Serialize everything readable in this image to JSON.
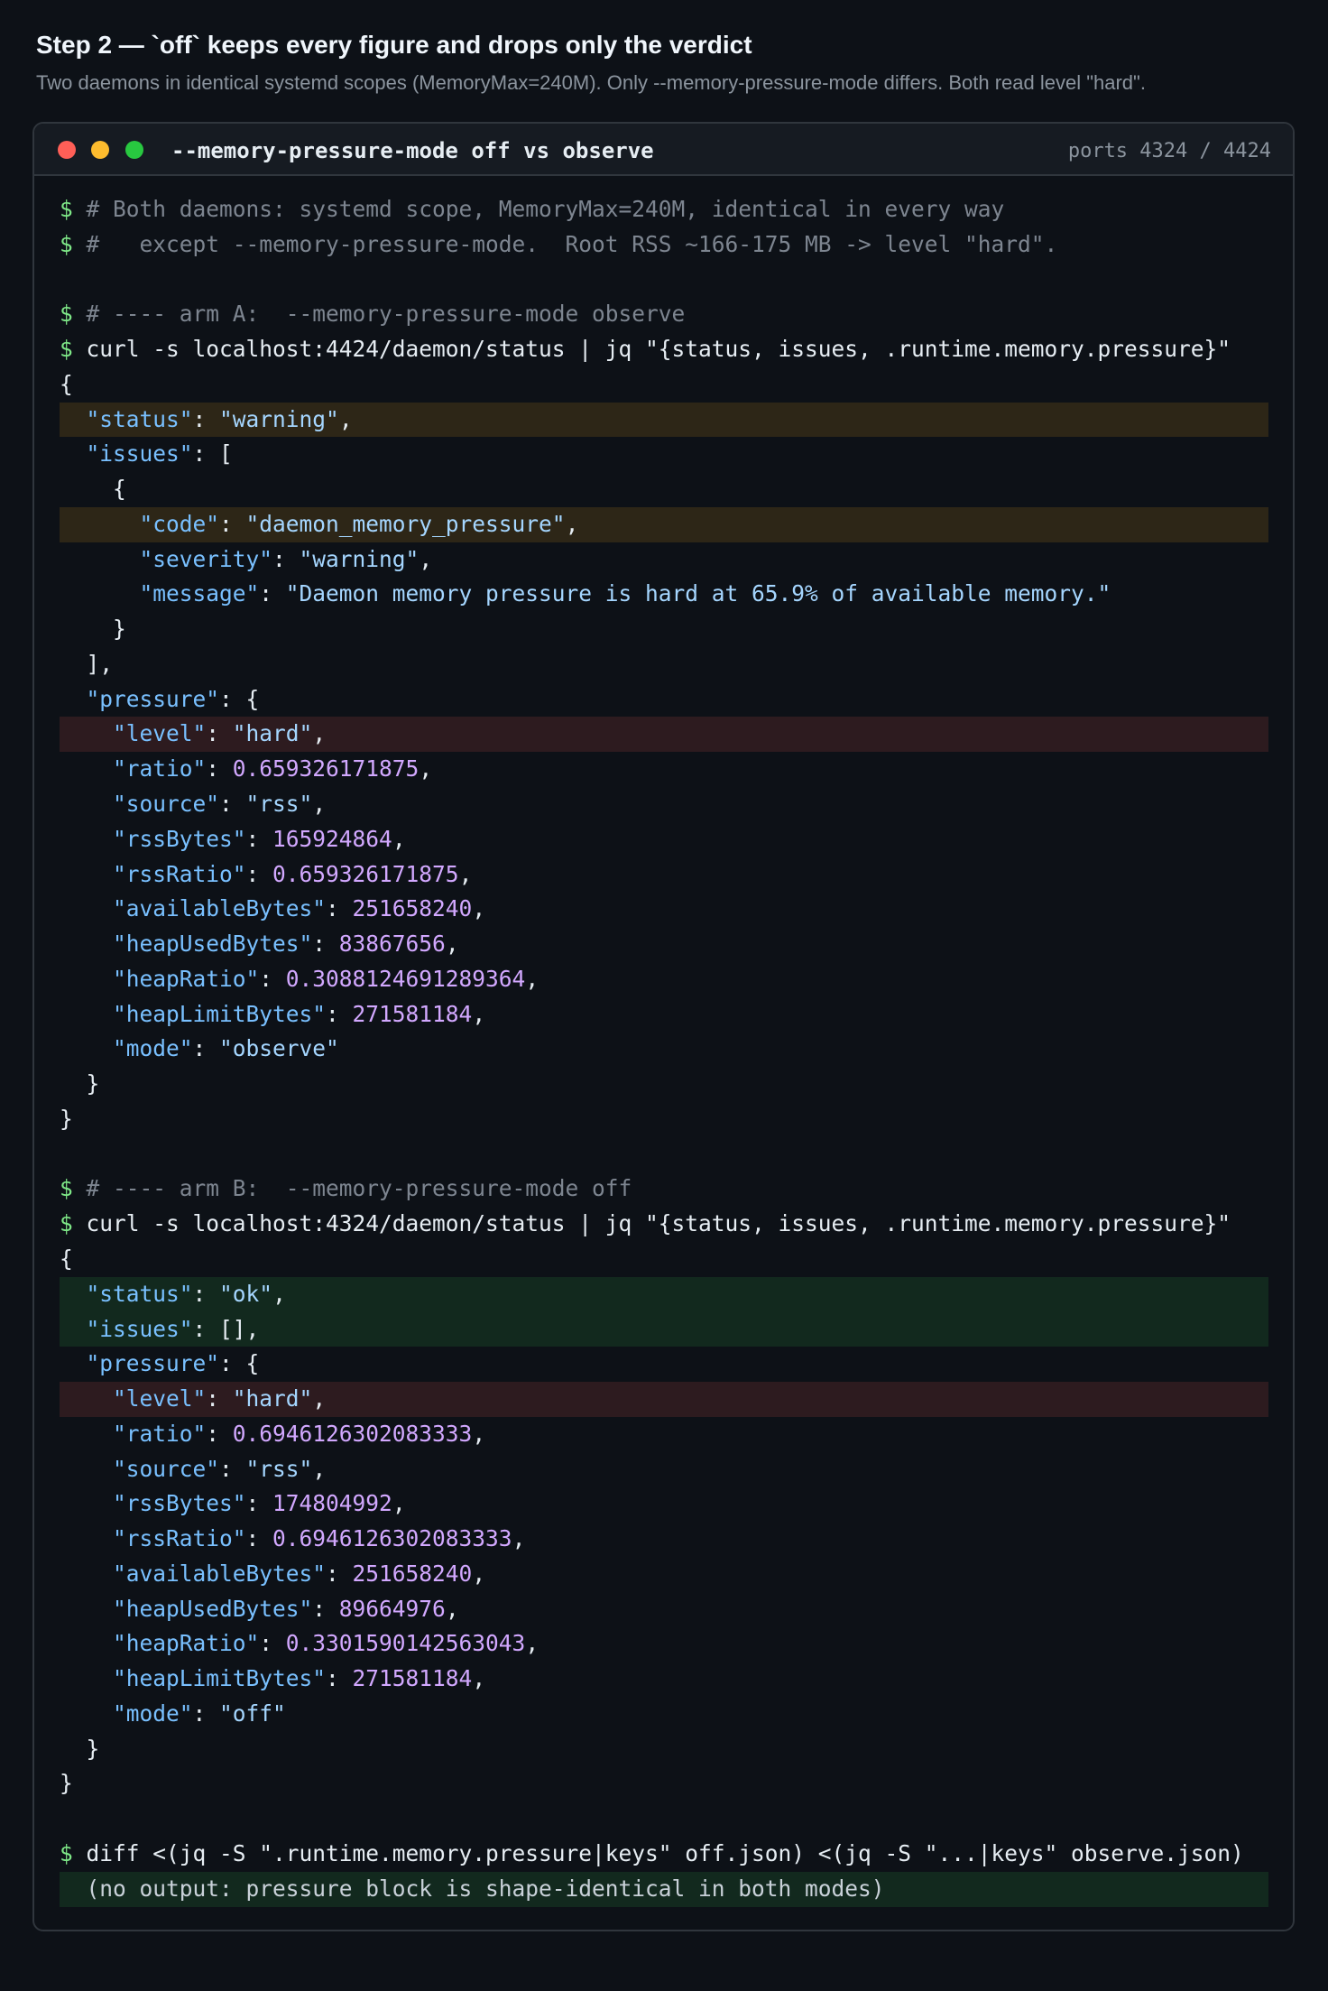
{
  "heading": "Step 2 — `off` keeps every figure and drops only the verdict",
  "subheading": "Two daemons in identical systemd scopes (MemoryMax=240M). Only --memory-pressure-mode differs. Both read level \"hard\".",
  "terminal": {
    "title": "--memory-pressure-mode off vs observe",
    "ports": "ports 4324 / 4424",
    "window_controls": [
      "close-dot",
      "minimize-dot",
      "maximize-dot"
    ],
    "colors": {
      "highlight_warning": "#2d2617",
      "highlight_level": "#2d1b1f",
      "highlight_ok": "#12291e",
      "prompt": "#7ee787",
      "key": "#79c0ff",
      "number": "#d2a8ff"
    }
  },
  "lines": [
    {
      "hl": "",
      "segs": [
        {
          "t": "p",
          "v": "$ "
        },
        {
          "t": "c",
          "v": "# Both daemons: systemd scope, MemoryMax=240M, identical in every way"
        }
      ]
    },
    {
      "hl": "",
      "segs": [
        {
          "t": "p",
          "v": "$ "
        },
        {
          "t": "c",
          "v": "#   except --memory-pressure-mode.  Root RSS ~166-175 MB -> level \"hard\"."
        }
      ]
    },
    {
      "hl": "",
      "segs": []
    },
    {
      "hl": "",
      "segs": [
        {
          "t": "p",
          "v": "$ "
        },
        {
          "t": "c",
          "v": "# ---- arm A:  --memory-pressure-mode observe"
        }
      ]
    },
    {
      "hl": "",
      "segs": [
        {
          "t": "p",
          "v": "$ "
        },
        {
          "t": "w",
          "v": "curl -s localhost:4424/daemon/status | jq \"{status, issues, .runtime.memory.pressure}\""
        }
      ]
    },
    {
      "hl": "",
      "segs": [
        {
          "t": "w",
          "v": "{"
        }
      ]
    },
    {
      "hl": "amber",
      "segs": [
        {
          "t": "w",
          "v": "  "
        },
        {
          "t": "k",
          "v": "\"status\""
        },
        {
          "t": "w",
          "v": ": "
        },
        {
          "t": "s",
          "v": "\"warning\""
        },
        {
          "t": "w",
          "v": ","
        }
      ]
    },
    {
      "hl": "",
      "segs": [
        {
          "t": "w",
          "v": "  "
        },
        {
          "t": "k",
          "v": "\"issues\""
        },
        {
          "t": "w",
          "v": ": ["
        }
      ]
    },
    {
      "hl": "",
      "segs": [
        {
          "t": "w",
          "v": "    {"
        }
      ]
    },
    {
      "hl": "amber",
      "segs": [
        {
          "t": "w",
          "v": "      "
        },
        {
          "t": "k",
          "v": "\"code\""
        },
        {
          "t": "w",
          "v": ": "
        },
        {
          "t": "s",
          "v": "\"daemon_memory_pressure\""
        },
        {
          "t": "w",
          "v": ","
        }
      ]
    },
    {
      "hl": "",
      "segs": [
        {
          "t": "w",
          "v": "      "
        },
        {
          "t": "k",
          "v": "\"severity\""
        },
        {
          "t": "w",
          "v": ": "
        },
        {
          "t": "s",
          "v": "\"warning\""
        },
        {
          "t": "w",
          "v": ","
        }
      ]
    },
    {
      "hl": "",
      "segs": [
        {
          "t": "w",
          "v": "      "
        },
        {
          "t": "k",
          "v": "\"message\""
        },
        {
          "t": "w",
          "v": ": "
        },
        {
          "t": "s",
          "v": "\"Daemon memory pressure is hard at 65.9% of available memory.\""
        }
      ]
    },
    {
      "hl": "",
      "segs": [
        {
          "t": "w",
          "v": "    }"
        }
      ]
    },
    {
      "hl": "",
      "segs": [
        {
          "t": "w",
          "v": "  ],"
        }
      ]
    },
    {
      "hl": "",
      "segs": [
        {
          "t": "w",
          "v": "  "
        },
        {
          "t": "k",
          "v": "\"pressure\""
        },
        {
          "t": "w",
          "v": ": {"
        }
      ]
    },
    {
      "hl": "red",
      "segs": [
        {
          "t": "w",
          "v": "    "
        },
        {
          "t": "k",
          "v": "\"level\""
        },
        {
          "t": "w",
          "v": ": "
        },
        {
          "t": "s",
          "v": "\"hard\""
        },
        {
          "t": "w",
          "v": ","
        }
      ]
    },
    {
      "hl": "",
      "segs": [
        {
          "t": "w",
          "v": "    "
        },
        {
          "t": "k",
          "v": "\"ratio\""
        },
        {
          "t": "w",
          "v": ": "
        },
        {
          "t": "n",
          "v": "0.659326171875"
        },
        {
          "t": "w",
          "v": ","
        }
      ]
    },
    {
      "hl": "",
      "segs": [
        {
          "t": "w",
          "v": "    "
        },
        {
          "t": "k",
          "v": "\"source\""
        },
        {
          "t": "w",
          "v": ": "
        },
        {
          "t": "s",
          "v": "\"rss\""
        },
        {
          "t": "w",
          "v": ","
        }
      ]
    },
    {
      "hl": "",
      "segs": [
        {
          "t": "w",
          "v": "    "
        },
        {
          "t": "k",
          "v": "\"rssBytes\""
        },
        {
          "t": "w",
          "v": ": "
        },
        {
          "t": "n",
          "v": "165924864"
        },
        {
          "t": "w",
          "v": ","
        }
      ]
    },
    {
      "hl": "",
      "segs": [
        {
          "t": "w",
          "v": "    "
        },
        {
          "t": "k",
          "v": "\"rssRatio\""
        },
        {
          "t": "w",
          "v": ": "
        },
        {
          "t": "n",
          "v": "0.659326171875"
        },
        {
          "t": "w",
          "v": ","
        }
      ]
    },
    {
      "hl": "",
      "segs": [
        {
          "t": "w",
          "v": "    "
        },
        {
          "t": "k",
          "v": "\"availableBytes\""
        },
        {
          "t": "w",
          "v": ": "
        },
        {
          "t": "n",
          "v": "251658240"
        },
        {
          "t": "w",
          "v": ","
        }
      ]
    },
    {
      "hl": "",
      "segs": [
        {
          "t": "w",
          "v": "    "
        },
        {
          "t": "k",
          "v": "\"heapUsedBytes\""
        },
        {
          "t": "w",
          "v": ": "
        },
        {
          "t": "n",
          "v": "83867656"
        },
        {
          "t": "w",
          "v": ","
        }
      ]
    },
    {
      "hl": "",
      "segs": [
        {
          "t": "w",
          "v": "    "
        },
        {
          "t": "k",
          "v": "\"heapRatio\""
        },
        {
          "t": "w",
          "v": ": "
        },
        {
          "t": "n",
          "v": "0.3088124691289364"
        },
        {
          "t": "w",
          "v": ","
        }
      ]
    },
    {
      "hl": "",
      "segs": [
        {
          "t": "w",
          "v": "    "
        },
        {
          "t": "k",
          "v": "\"heapLimitBytes\""
        },
        {
          "t": "w",
          "v": ": "
        },
        {
          "t": "n",
          "v": "271581184"
        },
        {
          "t": "w",
          "v": ","
        }
      ]
    },
    {
      "hl": "",
      "segs": [
        {
          "t": "w",
          "v": "    "
        },
        {
          "t": "k",
          "v": "\"mode\""
        },
        {
          "t": "w",
          "v": ": "
        },
        {
          "t": "s",
          "v": "\"observe\""
        }
      ]
    },
    {
      "hl": "",
      "segs": [
        {
          "t": "w",
          "v": "  }"
        }
      ]
    },
    {
      "hl": "",
      "segs": [
        {
          "t": "w",
          "v": "}"
        }
      ]
    },
    {
      "hl": "",
      "segs": []
    },
    {
      "hl": "",
      "segs": [
        {
          "t": "p",
          "v": "$ "
        },
        {
          "t": "c",
          "v": "# ---- arm B:  --memory-pressure-mode off"
        }
      ]
    },
    {
      "hl": "",
      "segs": [
        {
          "t": "p",
          "v": "$ "
        },
        {
          "t": "w",
          "v": "curl -s localhost:4324/daemon/status | jq \"{status, issues, .runtime.memory.pressure}\""
        }
      ]
    },
    {
      "hl": "",
      "segs": [
        {
          "t": "w",
          "v": "{"
        }
      ]
    },
    {
      "hl": "green",
      "segs": [
        {
          "t": "w",
          "v": "  "
        },
        {
          "t": "k",
          "v": "\"status\""
        },
        {
          "t": "w",
          "v": ": "
        },
        {
          "t": "s",
          "v": "\"ok\""
        },
        {
          "t": "w",
          "v": ","
        }
      ]
    },
    {
      "hl": "green",
      "segs": [
        {
          "t": "w",
          "v": "  "
        },
        {
          "t": "k",
          "v": "\"issues\""
        },
        {
          "t": "w",
          "v": ": [],"
        }
      ]
    },
    {
      "hl": "",
      "segs": [
        {
          "t": "w",
          "v": "  "
        },
        {
          "t": "k",
          "v": "\"pressure\""
        },
        {
          "t": "w",
          "v": ": {"
        }
      ]
    },
    {
      "hl": "red",
      "segs": [
        {
          "t": "w",
          "v": "    "
        },
        {
          "t": "k",
          "v": "\"level\""
        },
        {
          "t": "w",
          "v": ": "
        },
        {
          "t": "s",
          "v": "\"hard\""
        },
        {
          "t": "w",
          "v": ","
        }
      ]
    },
    {
      "hl": "",
      "segs": [
        {
          "t": "w",
          "v": "    "
        },
        {
          "t": "k",
          "v": "\"ratio\""
        },
        {
          "t": "w",
          "v": ": "
        },
        {
          "t": "n",
          "v": "0.6946126302083333"
        },
        {
          "t": "w",
          "v": ","
        }
      ]
    },
    {
      "hl": "",
      "segs": [
        {
          "t": "w",
          "v": "    "
        },
        {
          "t": "k",
          "v": "\"source\""
        },
        {
          "t": "w",
          "v": ": "
        },
        {
          "t": "s",
          "v": "\"rss\""
        },
        {
          "t": "w",
          "v": ","
        }
      ]
    },
    {
      "hl": "",
      "segs": [
        {
          "t": "w",
          "v": "    "
        },
        {
          "t": "k",
          "v": "\"rssBytes\""
        },
        {
          "t": "w",
          "v": ": "
        },
        {
          "t": "n",
          "v": "174804992"
        },
        {
          "t": "w",
          "v": ","
        }
      ]
    },
    {
      "hl": "",
      "segs": [
        {
          "t": "w",
          "v": "    "
        },
        {
          "t": "k",
          "v": "\"rssRatio\""
        },
        {
          "t": "w",
          "v": ": "
        },
        {
          "t": "n",
          "v": "0.6946126302083333"
        },
        {
          "t": "w",
          "v": ","
        }
      ]
    },
    {
      "hl": "",
      "segs": [
        {
          "t": "w",
          "v": "    "
        },
        {
          "t": "k",
          "v": "\"availableBytes\""
        },
        {
          "t": "w",
          "v": ": "
        },
        {
          "t": "n",
          "v": "251658240"
        },
        {
          "t": "w",
          "v": ","
        }
      ]
    },
    {
      "hl": "",
      "segs": [
        {
          "t": "w",
          "v": "    "
        },
        {
          "t": "k",
          "v": "\"heapUsedBytes\""
        },
        {
          "t": "w",
          "v": ": "
        },
        {
          "t": "n",
          "v": "89664976"
        },
        {
          "t": "w",
          "v": ","
        }
      ]
    },
    {
      "hl": "",
      "segs": [
        {
          "t": "w",
          "v": "    "
        },
        {
          "t": "k",
          "v": "\"heapRatio\""
        },
        {
          "t": "w",
          "v": ": "
        },
        {
          "t": "n",
          "v": "0.3301590142563043"
        },
        {
          "t": "w",
          "v": ","
        }
      ]
    },
    {
      "hl": "",
      "segs": [
        {
          "t": "w",
          "v": "    "
        },
        {
          "t": "k",
          "v": "\"heapLimitBytes\""
        },
        {
          "t": "w",
          "v": ": "
        },
        {
          "t": "n",
          "v": "271581184"
        },
        {
          "t": "w",
          "v": ","
        }
      ]
    },
    {
      "hl": "",
      "segs": [
        {
          "t": "w",
          "v": "    "
        },
        {
          "t": "k",
          "v": "\"mode\""
        },
        {
          "t": "w",
          "v": ": "
        },
        {
          "t": "s",
          "v": "\"off\""
        }
      ]
    },
    {
      "hl": "",
      "segs": [
        {
          "t": "w",
          "v": "  }"
        }
      ]
    },
    {
      "hl": "",
      "segs": [
        {
          "t": "w",
          "v": "}"
        }
      ]
    },
    {
      "hl": "",
      "segs": []
    },
    {
      "hl": "",
      "segs": [
        {
          "t": "p",
          "v": "$ "
        },
        {
          "t": "w",
          "v": "diff <(jq -S \".runtime.memory.pressure|keys\" off.json) <(jq -S \"...|keys\" observe.json)"
        }
      ]
    },
    {
      "hl": "green",
      "segs": [
        {
          "t": "dim",
          "v": "  (no output: pressure block is shape-identical in both modes)"
        }
      ]
    }
  ]
}
